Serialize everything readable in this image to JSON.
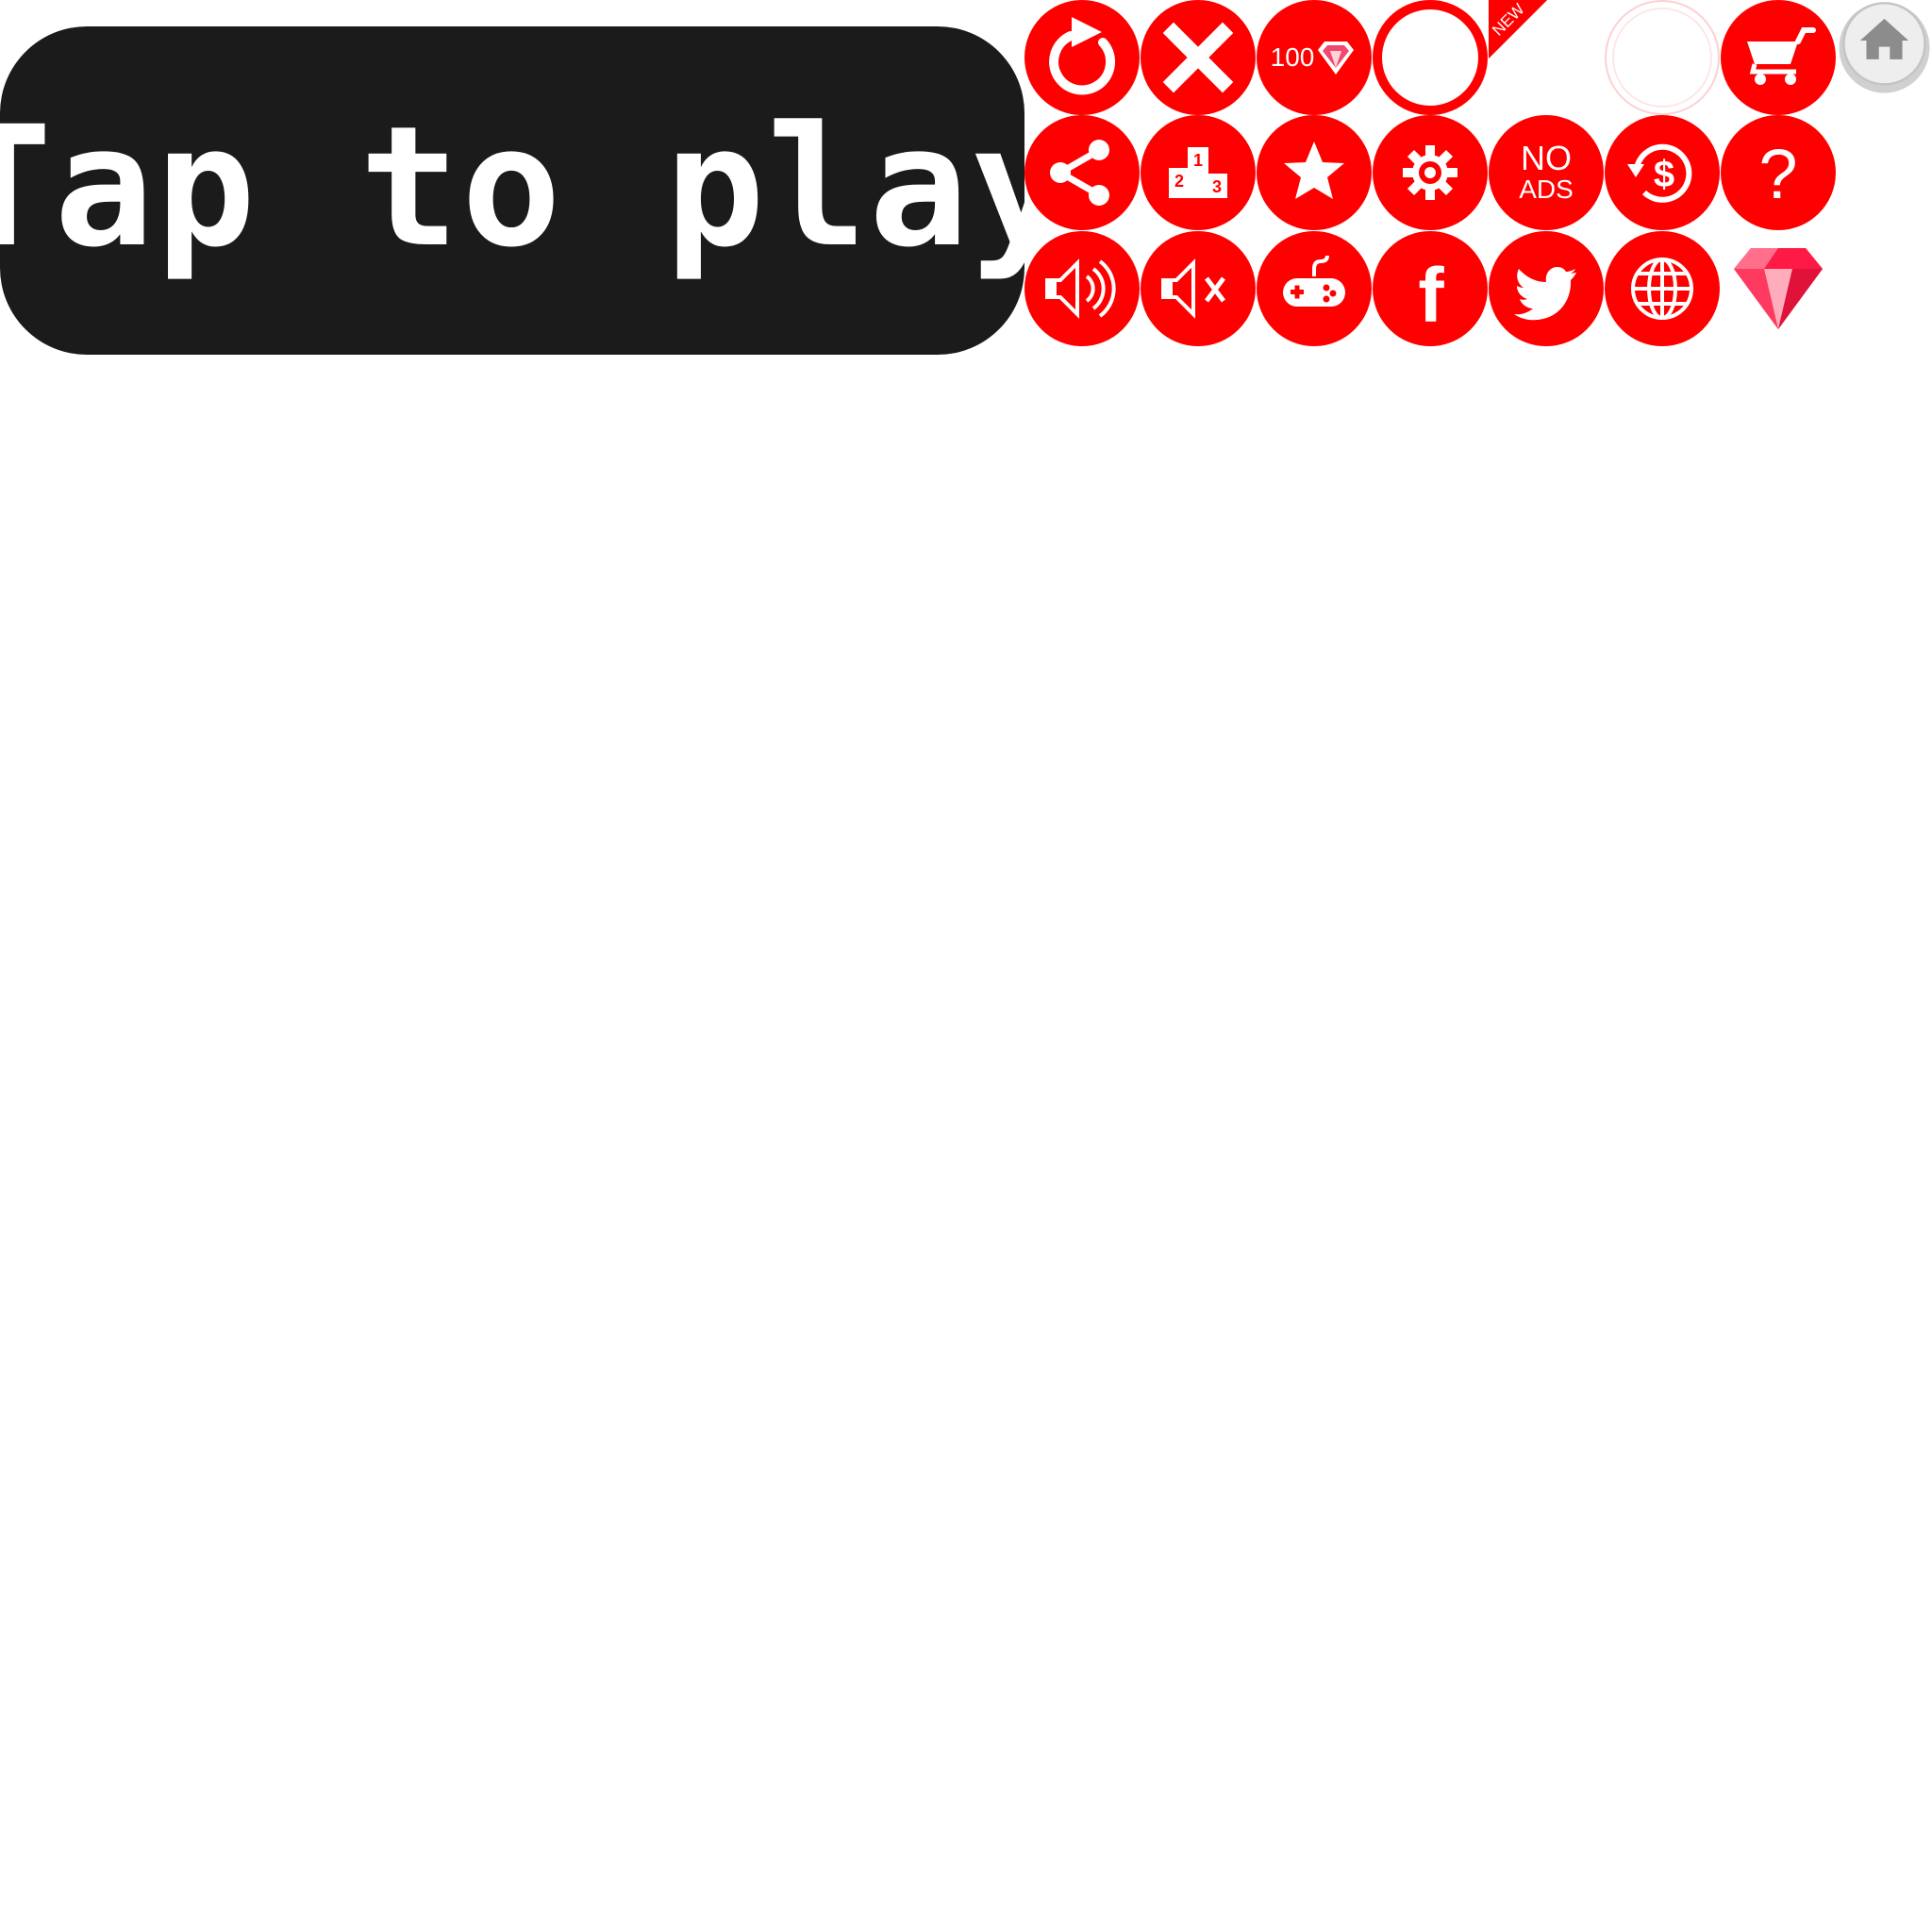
{
  "play_button": {
    "label": "Tap to play"
  },
  "colors": {
    "accent": "#ff0000",
    "banner": "#1b1b1b",
    "icon": "#ffffff",
    "gem": "#f0486e",
    "home_button": "#e6e6e6",
    "home_icon": "#8c8c8c"
  },
  "gem_bundle": {
    "amount": "100"
  },
  "new_ribbon": {
    "label": "NEW"
  },
  "no_ads": {
    "line1": "NO",
    "line2": "ADS"
  },
  "help": {
    "glyph": "?"
  },
  "facebook": {
    "glyph": "f"
  },
  "leaderboard": {
    "first": "1",
    "second": "2",
    "third": "3"
  },
  "icons": [
    "restart-icon",
    "close-icon",
    "gem-bundle-icon",
    "empty-ring-icon",
    "new-ribbon",
    "faint-ring-icon",
    "cart-icon",
    "home-icon",
    "share-icon",
    "leaderboard-icon",
    "star-icon",
    "settings-icon",
    "no-ads-icon",
    "restore-purchase-icon",
    "help-icon",
    "sound-on-icon",
    "sound-off-icon",
    "gamepad-icon",
    "facebook-icon",
    "twitter-icon",
    "globe-icon",
    "gem-icon"
  ]
}
